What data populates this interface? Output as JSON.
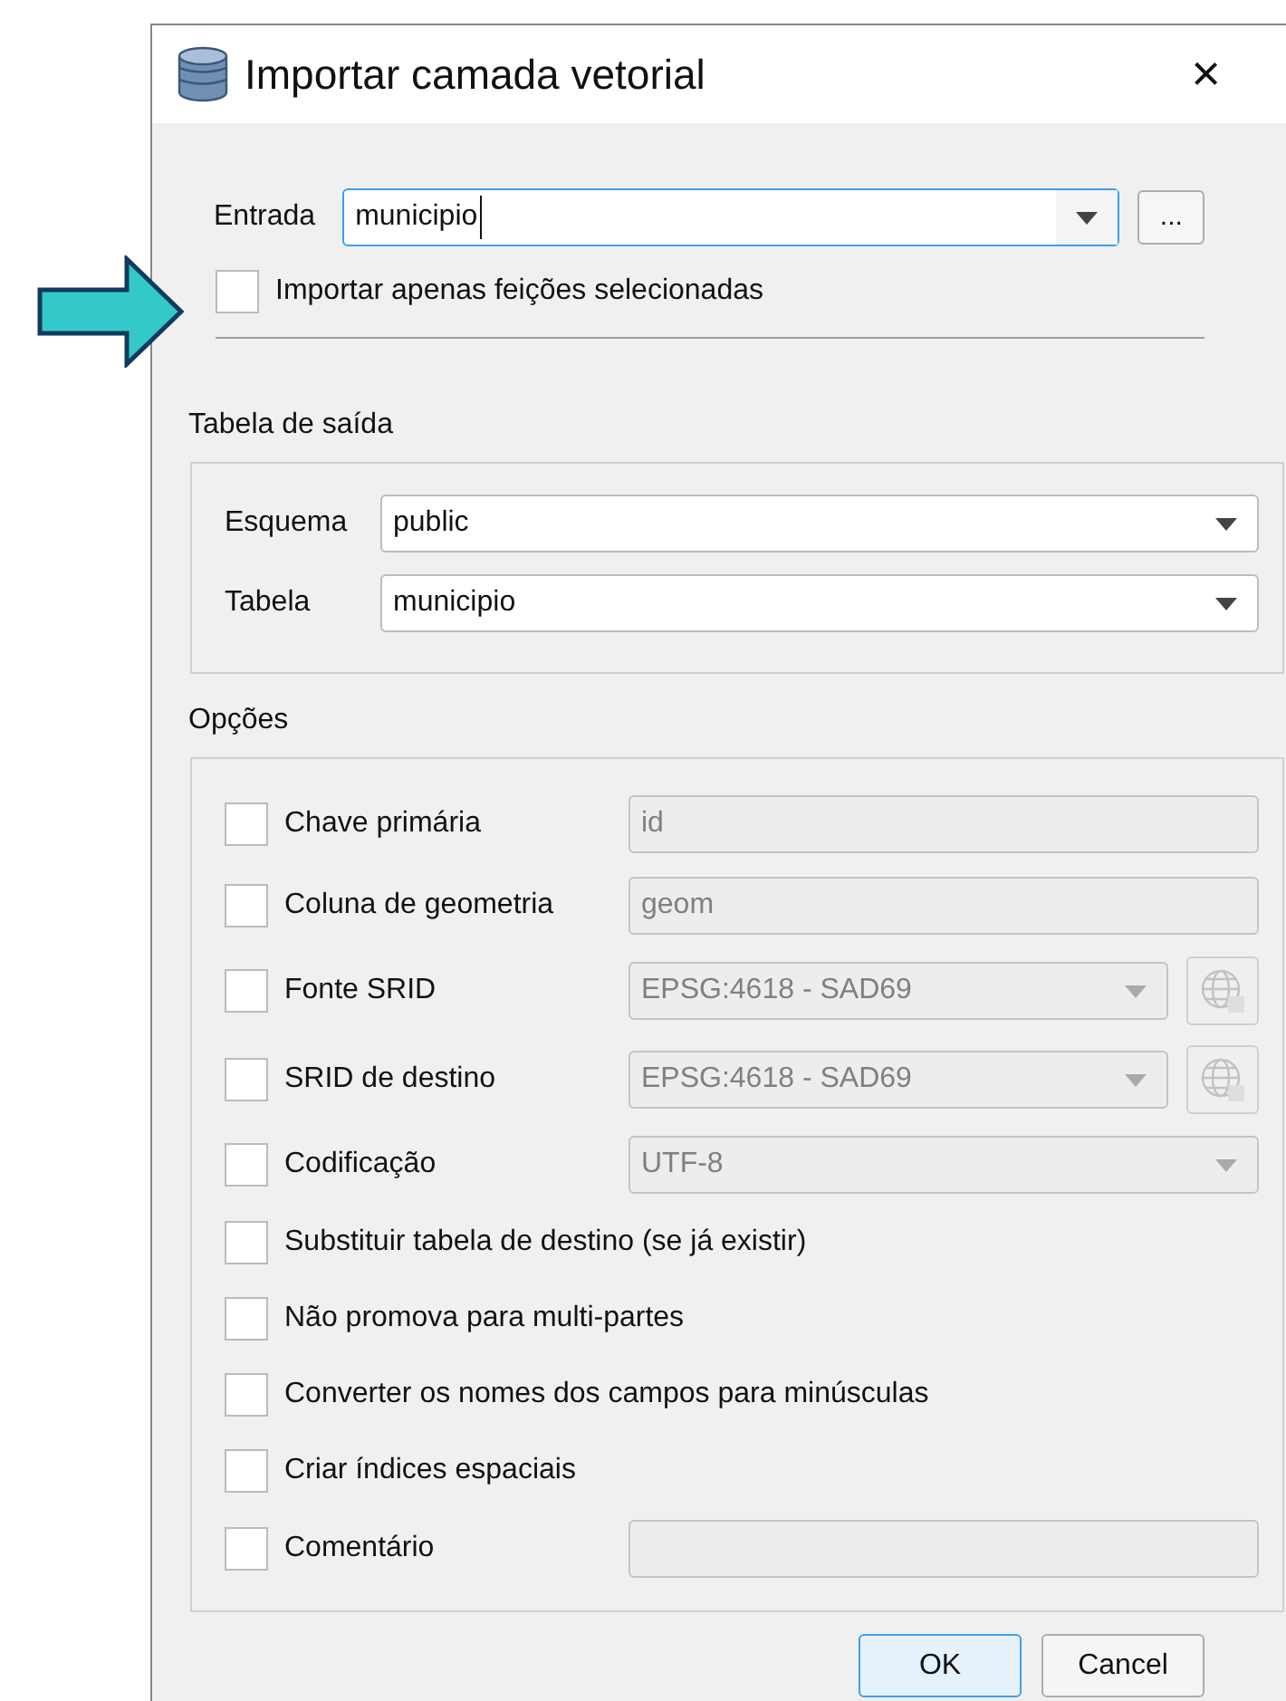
{
  "window": {
    "title": "Importar camada vetorial",
    "close": "×"
  },
  "input": {
    "label": "Entrada",
    "value": "municipio",
    "browse": "...",
    "selected_only": {
      "label": "Importar apenas feições selecionadas",
      "checked": false
    }
  },
  "output_table": {
    "title": "Tabela de saída",
    "rows": [
      {
        "label": "Esquema",
        "value": "public"
      },
      {
        "label": "Tabela",
        "value": "municipio"
      }
    ]
  },
  "options": {
    "title": "Opções",
    "rows": [
      {
        "kind": "text",
        "label": "Chave primária",
        "checked": false,
        "value": "id",
        "disabled": true
      },
      {
        "kind": "text",
        "label": "Coluna de geometria",
        "checked": false,
        "value": "geom",
        "disabled": true
      },
      {
        "kind": "crs",
        "label": "Fonte SRID",
        "checked": false,
        "value": "EPSG:4618 - SAD69",
        "disabled": true
      },
      {
        "kind": "crs",
        "label": "SRID de destino",
        "checked": false,
        "value": "EPSG:4618 - SAD69",
        "disabled": true
      },
      {
        "kind": "combo",
        "label": "Codificação",
        "checked": false,
        "value": "UTF-8",
        "disabled": true
      },
      {
        "kind": "plain",
        "label": "Substituir tabela de destino (se já existir)",
        "checked": false
      },
      {
        "kind": "plain",
        "label": "Não promova para multi-partes",
        "checked": false
      },
      {
        "kind": "plain",
        "label": "Converter os nomes dos campos para minúsculas",
        "checked": false
      },
      {
        "kind": "plain",
        "label": "Criar índices espaciais",
        "checked": false
      },
      {
        "kind": "text",
        "label": "Comentário",
        "checked": false,
        "disabled": true
      }
    ]
  },
  "buttons": [
    {
      "label": "OK",
      "default": true
    },
    {
      "label": "Cancel",
      "default": false
    }
  ]
}
